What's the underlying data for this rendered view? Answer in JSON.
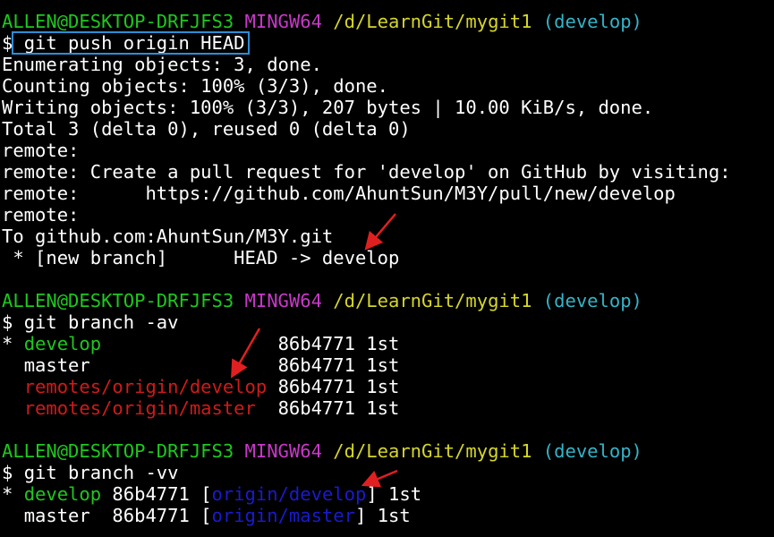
{
  "prompt1": {
    "user_host": "ALLEN@DESKTOP-DRFJFS3",
    "shell": "MINGW64",
    "path": "/d/LearnGit/mygit1",
    "branch": "(develop)"
  },
  "cmd1": {
    "symbol": "$",
    "command": "git push origin HEAD"
  },
  "push_output": [
    "Enumerating objects: 3, done.",
    "Counting objects: 100% (3/3), done.",
    "Writing objects: 100% (3/3), 207 bytes | 10.00 KiB/s, done.",
    "Total 3 (delta 0), reused 0 (delta 0)",
    "remote:",
    "remote: Create a pull request for 'develop' on GitHub by visiting:",
    "remote:      https://github.com/AhuntSun/M3Y/pull/new/develop",
    "remote:",
    "To github.com:AhuntSun/M3Y.git",
    " * [new branch]      HEAD -> develop"
  ],
  "prompt2": {
    "user_host": "ALLEN@DESKTOP-DRFJFS3",
    "shell": "MINGW64",
    "path": "/d/LearnGit/mygit1",
    "branch": "(develop)"
  },
  "cmd2": {
    "symbol": "$",
    "command": "git branch -av"
  },
  "branch_av": [
    {
      "marker": "* ",
      "name": "develop                ",
      "rest": "86b4771 1st"
    },
    {
      "marker": "  ",
      "name": "master                 ",
      "rest": "86b4771 1st"
    },
    {
      "marker": "  ",
      "name": "remotes/origin/develop ",
      "rest": "86b4771 1st"
    },
    {
      "marker": "  ",
      "name": "remotes/origin/master  ",
      "rest": "86b4771 1st"
    }
  ],
  "prompt3": {
    "user_host": "ALLEN@DESKTOP-DRFJFS3",
    "shell": "MINGW64",
    "path": "/d/LearnGit/mygit1",
    "branch": "(develop)"
  },
  "cmd3": {
    "symbol": "$",
    "command": "git branch -vv"
  },
  "branch_vv": [
    {
      "marker": "* ",
      "name": "develop",
      "hash": " 86b4771 ",
      "open": "[",
      "upstream": "origin/develop",
      "close": "]",
      "msg": " 1st"
    },
    {
      "marker": "  ",
      "name": "master",
      "hash": "  86b4771 ",
      "open": "[",
      "upstream": "origin/master",
      "close": "]",
      "msg": " 1st"
    }
  ],
  "colors": {
    "background": "#000000",
    "prompt_user": "#1ec81e",
    "prompt_shell": "#c838c8",
    "prompt_path": "#d6d62a",
    "prompt_branch": "#34b4c8",
    "current_branch": "#1ec81e",
    "remote_branch": "#d01a1a",
    "upstream": "#1a1ad0",
    "annotation_arrow": "#e02020",
    "highlight_box": "#2b8fd6"
  }
}
